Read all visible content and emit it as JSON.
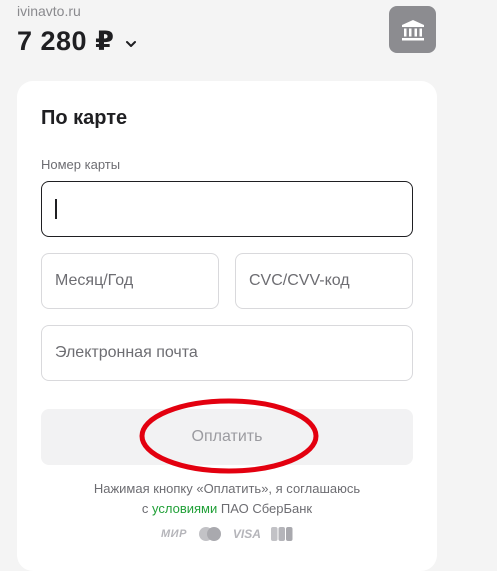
{
  "header": {
    "merchant": "ivinavto.ru",
    "amount": "7 280 ₽"
  },
  "form": {
    "title": "По карте",
    "card_number_label": "Номер карты",
    "month_year_placeholder": "Месяц/Год",
    "cvc_placeholder": "CVC/CVV-код",
    "email_placeholder": "Электронная почта",
    "pay_button": "Оплатить"
  },
  "consent": {
    "text_before": "Нажимая кнопку «Оплатить», я соглашаюсь",
    "text_prefix": "с",
    "link": "условиями",
    "text_after": "ПАО СберБанк"
  },
  "payment_logos": {
    "mir": "МИР",
    "visa": "VISA"
  },
  "colors": {
    "link": "#21a038",
    "highlight": "#e3000f",
    "bank_button": "#8c8c90"
  }
}
